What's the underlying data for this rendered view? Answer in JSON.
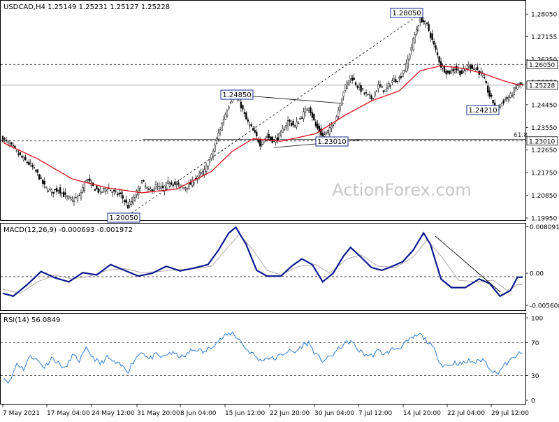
{
  "chart_data": [
    {
      "type": "candlestick",
      "title": "USDCAD,H4 1.25149 1.25231 1.25127 1.25228",
      "x_tick_labels": [
        "7 May 2021",
        "17 May 04:00",
        "24 May 12:00",
        "31 May 20:00",
        "8 Jun 04:00",
        "15 Jun 12:00",
        "22 Jun 20:00",
        "30 Jun 04:00",
        "7 Jul 12:00",
        "14 Jul 20:00",
        "22 Jul 04:00",
        "29 Jul 12:00"
      ],
      "y_tick_labels": [
        "1.28050",
        "1.27155",
        "1.26250",
        "1.25350",
        "1.24450",
        "1.23550",
        "1.22650",
        "1.21750",
        "1.20850",
        "1.19950"
      ],
      "ylim": [
        1.1995,
        1.285
      ],
      "price_tag_labels": [
        "1.26050",
        "1.25228",
        "1.23010"
      ],
      "price_tag_values": [
        1.2605,
        1.25228,
        1.2301
      ],
      "horizontal_levels": [
        1.2605,
        1.25228,
        1.2301
      ],
      "fib_label": "61.8",
      "annotations": [
        {
          "label": "1.28050",
          "value": 1.2805
        },
        {
          "label": "1.24850",
          "value": 1.2485
        },
        {
          "label": "1.24210",
          "value": 1.2421
        },
        {
          "label": "1.23010",
          "value": 1.2301
        },
        {
          "label": "1.20050",
          "value": 1.2005
        }
      ],
      "pivots": [
        {
          "index": 0,
          "price": 1.231
        },
        {
          "index": 4,
          "price": 1.2288
        },
        {
          "index": 8,
          "price": 1.2255
        },
        {
          "index": 12,
          "price": 1.2228
        },
        {
          "index": 16,
          "price": 1.2205
        },
        {
          "index": 20,
          "price": 1.217
        },
        {
          "index": 24,
          "price": 1.212
        },
        {
          "index": 28,
          "price": 1.2098
        },
        {
          "index": 32,
          "price": 1.211
        },
        {
          "index": 36,
          "price": 1.208
        },
        {
          "index": 40,
          "price": 1.2065
        },
        {
          "index": 44,
          "price": 1.208
        },
        {
          "index": 48,
          "price": 1.215
        },
        {
          "index": 52,
          "price": 1.2118
        },
        {
          "index": 56,
          "price": 1.2098
        },
        {
          "index": 60,
          "price": 1.2115
        },
        {
          "index": 64,
          "price": 1.2095
        },
        {
          "index": 68,
          "price": 1.2085
        },
        {
          "index": 72,
          "price": 1.204
        },
        {
          "index": 76,
          "price": 1.208
        },
        {
          "index": 80,
          "price": 1.214
        },
        {
          "index": 84,
          "price": 1.21
        },
        {
          "index": 88,
          "price": 1.212
        },
        {
          "index": 92,
          "price": 1.211
        },
        {
          "index": 96,
          "price": 1.214
        },
        {
          "index": 100,
          "price": 1.2125
        },
        {
          "index": 104,
          "price": 1.2115
        },
        {
          "index": 108,
          "price": 1.213
        },
        {
          "index": 112,
          "price": 1.216
        },
        {
          "index": 116,
          "price": 1.218
        },
        {
          "index": 120,
          "price": 1.224
        },
        {
          "index": 124,
          "price": 1.233
        },
        {
          "index": 128,
          "price": 1.241
        },
        {
          "index": 132,
          "price": 1.248
        },
        {
          "index": 136,
          "price": 1.246
        },
        {
          "index": 140,
          "price": 1.2385
        },
        {
          "index": 144,
          "price": 1.234
        },
        {
          "index": 148,
          "price": 1.229
        },
        {
          "index": 152,
          "price": 1.232
        },
        {
          "index": 156,
          "price": 1.23
        },
        {
          "index": 160,
          "price": 1.233
        },
        {
          "index": 164,
          "price": 1.238
        },
        {
          "index": 168,
          "price": 1.236
        },
        {
          "index": 172,
          "price": 1.24
        },
        {
          "index": 176,
          "price": 1.244
        },
        {
          "index": 180,
          "price": 1.236
        },
        {
          "index": 184,
          "price": 1.232
        },
        {
          "index": 188,
          "price": 1.2345
        },
        {
          "index": 192,
          "price": 1.24
        },
        {
          "index": 196,
          "price": 1.25
        },
        {
          "index": 200,
          "price": 1.256
        },
        {
          "index": 204,
          "price": 1.252
        },
        {
          "index": 208,
          "price": 1.249
        },
        {
          "index": 212,
          "price": 1.247
        },
        {
          "index": 216,
          "price": 1.252
        },
        {
          "index": 220,
          "price": 1.25
        },
        {
          "index": 224,
          "price": 1.254
        },
        {
          "index": 228,
          "price": 1.255
        },
        {
          "index": 232,
          "price": 1.26
        },
        {
          "index": 236,
          "price": 1.27
        },
        {
          "index": 240,
          "price": 1.279
        },
        {
          "index": 244,
          "price": 1.276
        },
        {
          "index": 248,
          "price": 1.268
        },
        {
          "index": 252,
          "price": 1.26
        },
        {
          "index": 256,
          "price": 1.257
        },
        {
          "index": 260,
          "price": 1.259
        },
        {
          "index": 264,
          "price": 1.257
        },
        {
          "index": 268,
          "price": 1.26
        },
        {
          "index": 272,
          "price": 1.259
        },
        {
          "index": 276,
          "price": 1.256
        },
        {
          "index": 280,
          "price": 1.248
        },
        {
          "index": 284,
          "price": 1.243
        },
        {
          "index": 288,
          "price": 1.246
        },
        {
          "index": 292,
          "price": 1.248
        },
        {
          "index": 296,
          "price": 1.2523
        }
      ],
      "moving_average_pivots": [
        {
          "index": 0,
          "price": 1.2295
        },
        {
          "index": 20,
          "price": 1.223
        },
        {
          "index": 40,
          "price": 1.215
        },
        {
          "index": 60,
          "price": 1.2115
        },
        {
          "index": 80,
          "price": 1.2095
        },
        {
          "index": 100,
          "price": 1.211
        },
        {
          "index": 120,
          "price": 1.218
        },
        {
          "index": 132,
          "price": 1.226
        },
        {
          "index": 144,
          "price": 1.231
        },
        {
          "index": 160,
          "price": 1.23
        },
        {
          "index": 180,
          "price": 1.233
        },
        {
          "index": 196,
          "price": 1.24
        },
        {
          "index": 212,
          "price": 1.246
        },
        {
          "index": 228,
          "price": 1.25
        },
        {
          "index": 240,
          "price": 1.258
        },
        {
          "index": 252,
          "price": 1.26
        },
        {
          "index": 264,
          "price": 1.259
        },
        {
          "index": 276,
          "price": 1.257
        },
        {
          "index": 288,
          "price": 1.254
        },
        {
          "index": 296,
          "price": 1.2525
        }
      ],
      "series_colors": {
        "candles": "#000000",
        "moving_average": "#e0101a",
        "levels": "#000000"
      }
    },
    {
      "type": "line",
      "title": "MACD(12,26,9) -0.000693 -0.001972",
      "y_tick_labels": [
        "0.008091",
        "0.00",
        "-0.005608"
      ],
      "ylim": [
        -0.0062,
        0.0084
      ],
      "macd_pivots": [
        {
          "index": 0,
          "value": -0.0035
        },
        {
          "index": 6,
          "value": -0.004
        },
        {
          "index": 14,
          "value": -0.002
        },
        {
          "index": 22,
          "value": 0.0003
        },
        {
          "index": 30,
          "value": -0.0008
        },
        {
          "index": 38,
          "value": -0.0015
        },
        {
          "index": 46,
          "value": 0.0001
        },
        {
          "index": 54,
          "value": -0.0003
        },
        {
          "index": 62,
          "value": 0.0015
        },
        {
          "index": 70,
          "value": 0.0005
        },
        {
          "index": 78,
          "value": -0.0005
        },
        {
          "index": 86,
          "value": 0.0
        },
        {
          "index": 94,
          "value": 0.0012
        },
        {
          "index": 102,
          "value": 0.0004
        },
        {
          "index": 110,
          "value": 0.0009
        },
        {
          "index": 118,
          "value": 0.0015
        },
        {
          "index": 124,
          "value": 0.004
        },
        {
          "index": 130,
          "value": 0.007
        },
        {
          "index": 134,
          "value": 0.008
        },
        {
          "index": 140,
          "value": 0.005
        },
        {
          "index": 146,
          "value": 0.0005
        },
        {
          "index": 152,
          "value": -0.0005
        },
        {
          "index": 160,
          "value": -0.0005
        },
        {
          "index": 166,
          "value": 0.0012
        },
        {
          "index": 172,
          "value": 0.0025
        },
        {
          "index": 178,
          "value": 0.0015
        },
        {
          "index": 184,
          "value": -0.0015
        },
        {
          "index": 190,
          "value": 0.0
        },
        {
          "index": 196,
          "value": 0.003
        },
        {
          "index": 200,
          "value": 0.0045
        },
        {
          "index": 206,
          "value": 0.0028
        },
        {
          "index": 212,
          "value": 0.001
        },
        {
          "index": 218,
          "value": 0.0005
        },
        {
          "index": 224,
          "value": 0.0012
        },
        {
          "index": 230,
          "value": 0.002
        },
        {
          "index": 236,
          "value": 0.004
        },
        {
          "index": 242,
          "value": 0.007
        },
        {
          "index": 246,
          "value": 0.005
        },
        {
          "index": 252,
          "value": -0.001
        },
        {
          "index": 258,
          "value": -0.0025
        },
        {
          "index": 266,
          "value": -0.0025
        },
        {
          "index": 274,
          "value": -0.001
        },
        {
          "index": 280,
          "value": -0.0018
        },
        {
          "index": 286,
          "value": -0.004
        },
        {
          "index": 292,
          "value": -0.003
        },
        {
          "index": 296,
          "value": -0.0007
        }
      ],
      "signal_pivots": [
        {
          "index": 0,
          "value": -0.0028
        },
        {
          "index": 10,
          "value": -0.0035
        },
        {
          "index": 20,
          "value": -0.0015
        },
        {
          "index": 30,
          "value": -0.0003
        },
        {
          "index": 40,
          "value": -0.001
        },
        {
          "index": 50,
          "value": -0.0005
        },
        {
          "index": 60,
          "value": 0.0005
        },
        {
          "index": 70,
          "value": 0.0008
        },
        {
          "index": 80,
          "value": 0.0001
        },
        {
          "index": 90,
          "value": 0.0003
        },
        {
          "index": 100,
          "value": 0.0006
        },
        {
          "index": 110,
          "value": 0.0008
        },
        {
          "index": 120,
          "value": 0.0012
        },
        {
          "index": 128,
          "value": 0.004
        },
        {
          "index": 136,
          "value": 0.0068
        },
        {
          "index": 144,
          "value": 0.004
        },
        {
          "index": 152,
          "value": 0.0005
        },
        {
          "index": 160,
          "value": -0.0003
        },
        {
          "index": 170,
          "value": 0.0012
        },
        {
          "index": 180,
          "value": 0.0015
        },
        {
          "index": 188,
          "value": 0.0
        },
        {
          "index": 198,
          "value": 0.0025
        },
        {
          "index": 206,
          "value": 0.0032
        },
        {
          "index": 216,
          "value": 0.0012
        },
        {
          "index": 226,
          "value": 0.001
        },
        {
          "index": 236,
          "value": 0.0028
        },
        {
          "index": 244,
          "value": 0.0058
        },
        {
          "index": 252,
          "value": 0.003
        },
        {
          "index": 262,
          "value": -0.0012
        },
        {
          "index": 272,
          "value": -0.0015
        },
        {
          "index": 282,
          "value": -0.0012
        },
        {
          "index": 290,
          "value": -0.003
        },
        {
          "index": 296,
          "value": -0.002
        }
      ],
      "series_colors": {
        "macd": "#0a1a8f",
        "signal": "#b0a8a8"
      }
    },
    {
      "type": "line",
      "title": "RSI(14) 56.0849",
      "y_tick_labels": [
        "100",
        "70",
        "30",
        "0"
      ],
      "ylim": [
        0,
        100
      ],
      "levels": [
        70,
        30
      ],
      "rsi_pivots": [
        {
          "index": 0,
          "value": 28
        },
        {
          "index": 4,
          "value": 22
        },
        {
          "index": 8,
          "value": 45
        },
        {
          "index": 12,
          "value": 38
        },
        {
          "index": 16,
          "value": 55
        },
        {
          "index": 20,
          "value": 48
        },
        {
          "index": 24,
          "value": 40
        },
        {
          "index": 28,
          "value": 52
        },
        {
          "index": 32,
          "value": 45
        },
        {
          "index": 36,
          "value": 38
        },
        {
          "index": 40,
          "value": 55
        },
        {
          "index": 44,
          "value": 48
        },
        {
          "index": 48,
          "value": 62
        },
        {
          "index": 52,
          "value": 52
        },
        {
          "index": 56,
          "value": 44
        },
        {
          "index": 60,
          "value": 52
        },
        {
          "index": 64,
          "value": 46
        },
        {
          "index": 68,
          "value": 42
        },
        {
          "index": 72,
          "value": 36
        },
        {
          "index": 76,
          "value": 50
        },
        {
          "index": 80,
          "value": 60
        },
        {
          "index": 84,
          "value": 50
        },
        {
          "index": 88,
          "value": 55
        },
        {
          "index": 92,
          "value": 52
        },
        {
          "index": 96,
          "value": 58
        },
        {
          "index": 100,
          "value": 55
        },
        {
          "index": 104,
          "value": 52
        },
        {
          "index": 108,
          "value": 60
        },
        {
          "index": 112,
          "value": 62
        },
        {
          "index": 116,
          "value": 58
        },
        {
          "index": 120,
          "value": 66
        },
        {
          "index": 124,
          "value": 72
        },
        {
          "index": 128,
          "value": 78
        },
        {
          "index": 132,
          "value": 82
        },
        {
          "index": 136,
          "value": 74
        },
        {
          "index": 140,
          "value": 62
        },
        {
          "index": 144,
          "value": 56
        },
        {
          "index": 148,
          "value": 48
        },
        {
          "index": 152,
          "value": 52
        },
        {
          "index": 156,
          "value": 50
        },
        {
          "index": 160,
          "value": 55
        },
        {
          "index": 164,
          "value": 60
        },
        {
          "index": 168,
          "value": 58
        },
        {
          "index": 172,
          "value": 66
        },
        {
          "index": 176,
          "value": 70
        },
        {
          "index": 180,
          "value": 55
        },
        {
          "index": 184,
          "value": 48
        },
        {
          "index": 188,
          "value": 52
        },
        {
          "index": 192,
          "value": 60
        },
        {
          "index": 196,
          "value": 68
        },
        {
          "index": 200,
          "value": 72
        },
        {
          "index": 204,
          "value": 62
        },
        {
          "index": 208,
          "value": 56
        },
        {
          "index": 212,
          "value": 54
        },
        {
          "index": 216,
          "value": 60
        },
        {
          "index": 220,
          "value": 56
        },
        {
          "index": 224,
          "value": 62
        },
        {
          "index": 228,
          "value": 64
        },
        {
          "index": 232,
          "value": 70
        },
        {
          "index": 236,
          "value": 76
        },
        {
          "index": 240,
          "value": 80
        },
        {
          "index": 244,
          "value": 72
        },
        {
          "index": 248,
          "value": 62
        },
        {
          "index": 252,
          "value": 44
        },
        {
          "index": 256,
          "value": 42
        },
        {
          "index": 260,
          "value": 46
        },
        {
          "index": 264,
          "value": 44
        },
        {
          "index": 268,
          "value": 48
        },
        {
          "index": 272,
          "value": 46
        },
        {
          "index": 276,
          "value": 50
        },
        {
          "index": 280,
          "value": 40
        },
        {
          "index": 284,
          "value": 32
        },
        {
          "index": 288,
          "value": 42
        },
        {
          "index": 292,
          "value": 48
        },
        {
          "index": 296,
          "value": 56
        }
      ],
      "series_colors": {
        "rsi": "#2f7fd6"
      }
    }
  ],
  "watermark": "ActionForex.com"
}
